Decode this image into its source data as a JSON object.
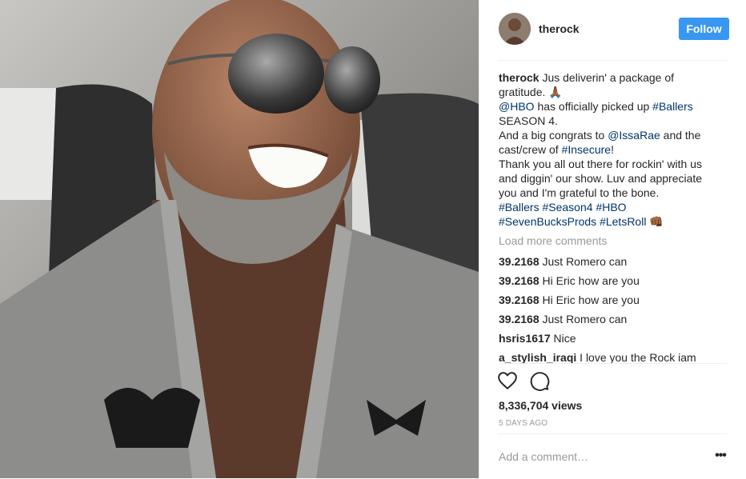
{
  "post": {
    "username": "therock",
    "follow_label": "Follow",
    "caption": {
      "author": "therock",
      "lines": [
        {
          "parts": [
            {
              "t": "Jus deliverin' a package of",
              "k": "text"
            }
          ]
        },
        {
          "parts": [
            {
              "t": "gratitude. 🙏🏾",
              "k": "text"
            }
          ]
        },
        {
          "parts": [
            {
              "t": "@HBO",
              "k": "link"
            },
            {
              "t": " has officially picked up ",
              "k": "text"
            },
            {
              "t": "#Ballers",
              "k": "link"
            }
          ]
        },
        {
          "parts": [
            {
              "t": "SEASON 4.",
              "k": "text"
            }
          ]
        },
        {
          "parts": [
            {
              "t": "And a big congrats to ",
              "k": "text"
            },
            {
              "t": "@IssaRae",
              "k": "link"
            },
            {
              "t": " and the",
              "k": "text"
            }
          ]
        },
        {
          "parts": [
            {
              "t": "cast/crew of ",
              "k": "text"
            },
            {
              "t": "#Insecure",
              "k": "link"
            },
            {
              "t": "!",
              "k": "text"
            }
          ]
        },
        {
          "parts": [
            {
              "t": "Thank you all out there for rockin' with us",
              "k": "text"
            }
          ]
        },
        {
          "parts": [
            {
              "t": "and diggin' our show. Luv and appreciate",
              "k": "text"
            }
          ]
        },
        {
          "parts": [
            {
              "t": "you and I'm grateful to the bone.",
              "k": "text"
            }
          ]
        },
        {
          "parts": [
            {
              "t": "#Ballers",
              "k": "link"
            },
            {
              "t": " ",
              "k": "text"
            },
            {
              "t": "#Season4",
              "k": "link"
            },
            {
              "t": " ",
              "k": "text"
            },
            {
              "t": "#HBO",
              "k": "link"
            }
          ]
        },
        {
          "parts": [
            {
              "t": "#SevenBucksProds",
              "k": "link"
            },
            {
              "t": " ",
              "k": "text"
            },
            {
              "t": "#LetsRoll",
              "k": "link"
            },
            {
              "t": " 👊🏾",
              "k": "text"
            }
          ]
        }
      ]
    },
    "load_more": "Load more comments",
    "comments": [
      {
        "user": "39.2168",
        "text": "Just Romero can"
      },
      {
        "user": "39.2168",
        "text": "Hi Eric how are you"
      },
      {
        "user": "39.2168",
        "text": "Hi Eric how are you"
      },
      {
        "user": "39.2168",
        "text": "Just Romero can"
      },
      {
        "user": "hsris1617",
        "text": "Nice"
      },
      {
        "user": "a_stylish_iraqi",
        "text": "I love you the Rock iam"
      }
    ],
    "views": "8,336,704 views",
    "time": "5 DAYS AGO",
    "comment_placeholder": "Add a comment…",
    "more_label": "•••"
  },
  "icons": {
    "like": "heart-icon",
    "comment": "comment-icon",
    "more": "more-options-icon"
  },
  "colors": {
    "accent": "#3897f0",
    "link": "#003569",
    "muted": "#999999"
  }
}
